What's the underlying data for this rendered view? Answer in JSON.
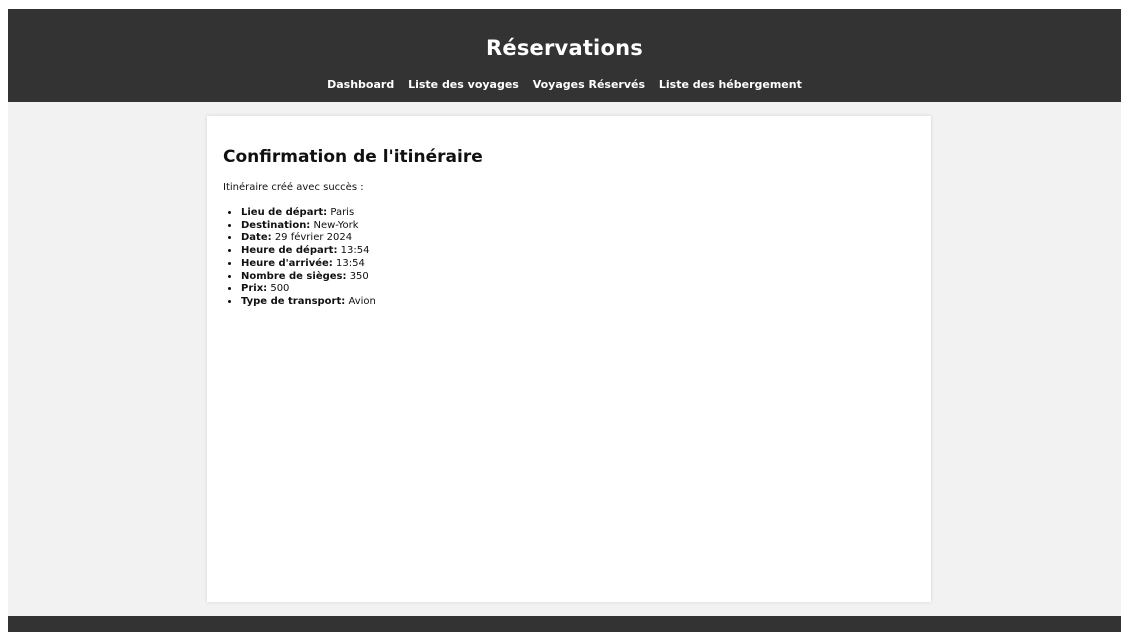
{
  "header": {
    "title": "Réservations",
    "nav": [
      "Dashboard",
      "Liste des voyages",
      "Voyages Réservés",
      "Liste des hébergement"
    ]
  },
  "card": {
    "heading": "Confirmation de l'itinéraire",
    "intro": "Itinéraire créé avec succès :",
    "details": [
      {
        "label": "Lieu de départ:",
        "value": "Paris"
      },
      {
        "label": "Destination:",
        "value": "New-York"
      },
      {
        "label": "Date:",
        "value": "29 février 2024"
      },
      {
        "label": "Heure de départ:",
        "value": "13:54"
      },
      {
        "label": "Heure d'arrivée:",
        "value": "13:54"
      },
      {
        "label": "Nombre de sièges:",
        "value": "350"
      },
      {
        "label": "Prix:",
        "value": "500"
      },
      {
        "label": "Type de transport:",
        "value": "Avion"
      }
    ]
  },
  "colors": {
    "header_bg": "#333333",
    "page_bg": "#f2f2f2",
    "card_bg": "#ffffff"
  }
}
